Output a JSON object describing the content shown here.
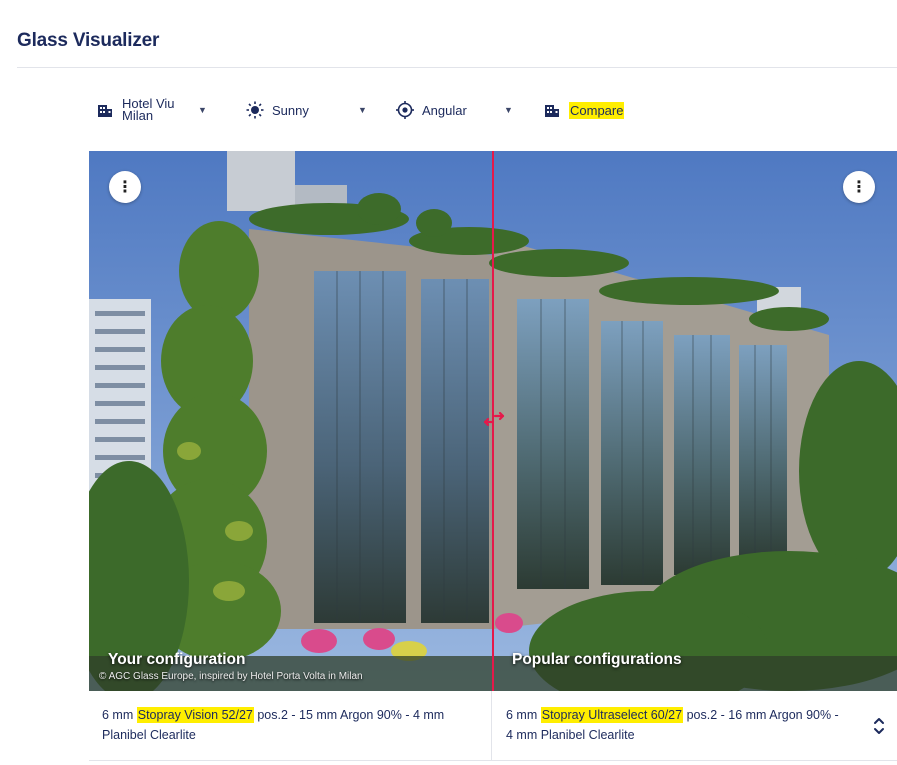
{
  "page": {
    "title": "Glass Visualizer"
  },
  "toolbar": {
    "building": {
      "label": "Hotel Viu Milan",
      "icon": "building-icon"
    },
    "weather": {
      "label": "Sunny",
      "icon": "sun-icon"
    },
    "view": {
      "label": "Angular",
      "icon": "camera-angle-icon"
    },
    "compare": {
      "label": "Compare",
      "icon": "building-compare-icon",
      "highlight": "#ffee00"
    }
  },
  "viewer": {
    "left_label": "Your configuration",
    "right_label": "Popular configurations",
    "credit": "© AGC Glass Europe, inspired by Hotel Porta Volta in Milan",
    "divider_color": "#e5194a"
  },
  "configs": {
    "left": {
      "prefix": "6 mm ",
      "product": "Stopray Vision 52/27",
      "suffix": " pos.2 - 15 mm Argon 90% - 4 mm Planibel Clearlite"
    },
    "right": {
      "prefix": "6 mm ",
      "product": "Stopray Ultraselect 60/27",
      "suffix": " pos.2 - 16 mm Argon 90% - 4 mm Planibel Clearlite"
    }
  },
  "colors": {
    "brand": "#1c2a5c",
    "highlight": "#ffee00",
    "accent": "#e5194a"
  }
}
